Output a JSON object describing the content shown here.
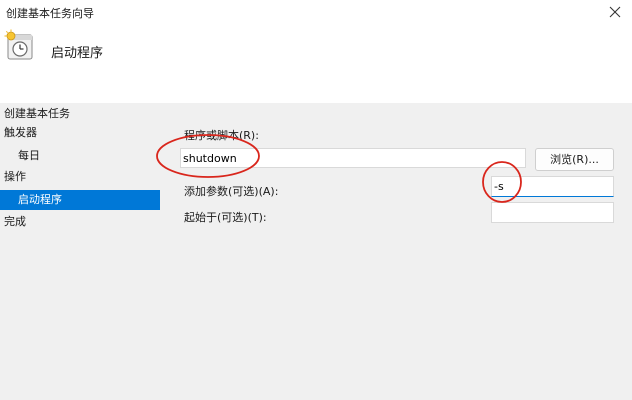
{
  "window": {
    "title": "创建基本任务向导"
  },
  "header": {
    "title": "启动程序",
    "icon": "task-clock-icon"
  },
  "nav": {
    "title": "创建基本任务",
    "items": [
      {
        "label": "触发器",
        "level": 0,
        "selected": false
      },
      {
        "label": "每日",
        "level": 1,
        "selected": false
      },
      {
        "label": "操作",
        "level": 0,
        "selected": false
      },
      {
        "label": "启动程序",
        "level": 1,
        "selected": true
      },
      {
        "label": "完成",
        "level": 0,
        "selected": false
      }
    ]
  },
  "form": {
    "program_label": "程序或脚本(R):",
    "program_value": "shutdown",
    "browse_label": "浏览(R)...",
    "args_label": "添加参数(可选)(A):",
    "args_value": "-s",
    "start_in_label": "起始于(可选)(T):",
    "start_in_value": ""
  },
  "colors": {
    "selection": "#0078d7",
    "annotation": "#d9261c",
    "background": "#f0f0f0"
  }
}
